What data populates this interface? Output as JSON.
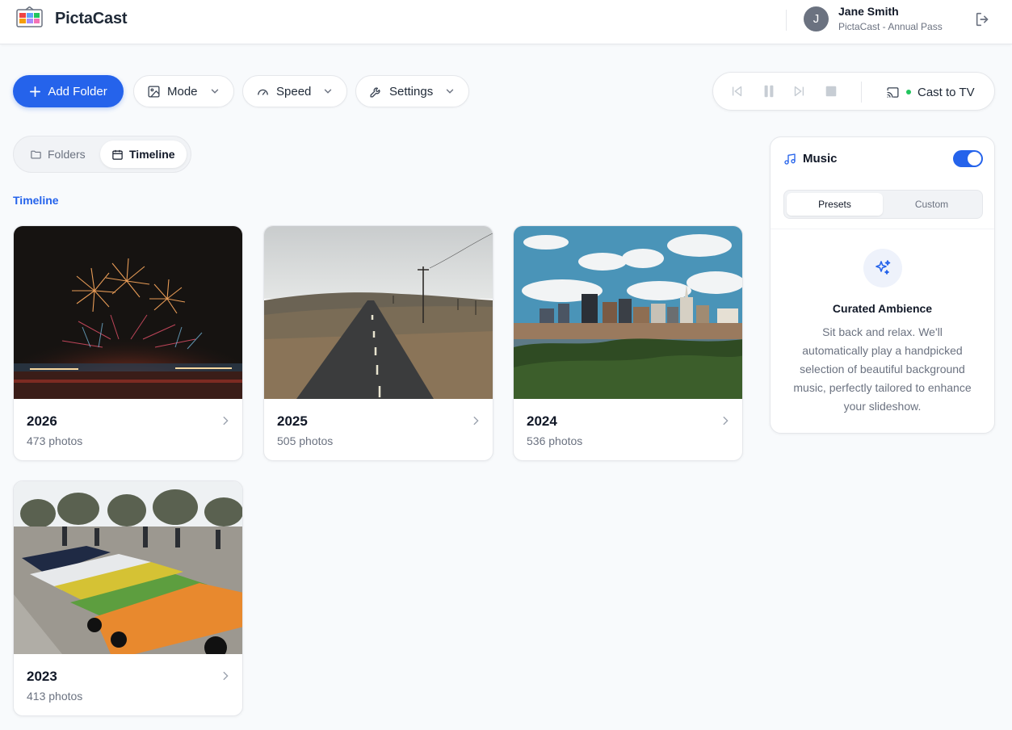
{
  "app": {
    "brand": "PictaCast"
  },
  "user": {
    "avatar_initial": "J",
    "name": "Jane Smith",
    "plan": "PictaCast - Annual Pass"
  },
  "toolbar": {
    "add_folder_label": "Add Folder",
    "mode_label": "Mode",
    "speed_label": "Speed",
    "settings_label": "Settings",
    "cast_label": "Cast to TV",
    "cast_status_color": "#22c55e"
  },
  "view_tabs": [
    {
      "label": "Folders",
      "active": false,
      "icon": "folder-icon"
    },
    {
      "label": "Timeline",
      "active": true,
      "icon": "calendar-icon"
    }
  ],
  "section_label": "Timeline",
  "cards": [
    {
      "year": "2026",
      "count": "473 photos",
      "image": "fireworks-photo"
    },
    {
      "year": "2025",
      "count": "505 photos",
      "image": "road-photo"
    },
    {
      "year": "2024",
      "count": "536 photos",
      "image": "city-skyline-photo"
    },
    {
      "year": "2023",
      "count": "413 photos",
      "image": "sports-cars-photo"
    }
  ],
  "music": {
    "title": "Music",
    "enabled": true,
    "tabs": [
      {
        "label": "Presets",
        "active": true
      },
      {
        "label": "Custom",
        "active": false
      }
    ],
    "preset_title": "Curated Ambience",
    "preset_body": "Sit back and relax. We'll automatically play a handpicked selection of beautiful background music, perfectly tailored to enhance your slideshow."
  },
  "colors": {
    "accent": "#2563eb",
    "background": "#f8fafc"
  }
}
